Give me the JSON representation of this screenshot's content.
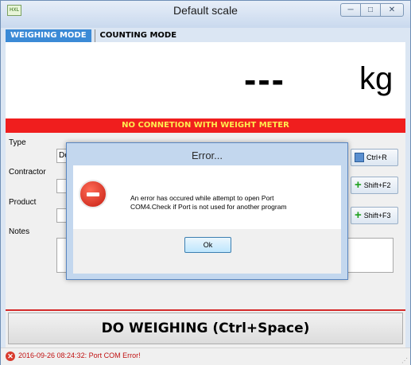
{
  "window": {
    "title": "Default scale",
    "app_icon_text": "HXL",
    "controls": [
      "minimize",
      "maximize",
      "close"
    ]
  },
  "tabs": [
    {
      "label": "WEIGHING MODE",
      "active": true
    },
    {
      "label": "COUNTING MODE",
      "active": false
    }
  ],
  "display": {
    "reading": "---",
    "unit": "kg"
  },
  "status_banner": {
    "text": "NO CONNETION WITH WEIGHT METER",
    "color": "#f01e1e"
  },
  "form": {
    "type_label": "Type",
    "type_value": "De",
    "contractor_label": "Contractor",
    "product_label": "Product",
    "notes_label": "Notes"
  },
  "shortcuts": [
    {
      "label": "Ctrl+R",
      "icon": "document-icon"
    },
    {
      "label": "Shift+F2",
      "icon": "plus-icon"
    },
    {
      "label": "Shift+F3",
      "icon": "plus-icon"
    }
  ],
  "main_button": {
    "label": "DO WEIGHING (Ctrl+Space)"
  },
  "footer": {
    "message": "2016-09-26 08:24:32: Port COM Error!"
  },
  "dialog": {
    "title": "Error...",
    "message_line1": "An error has occured while attempt to open Port",
    "message_line2": "COM4.Check if Port is not used for another program",
    "ok_label": "Ok"
  }
}
